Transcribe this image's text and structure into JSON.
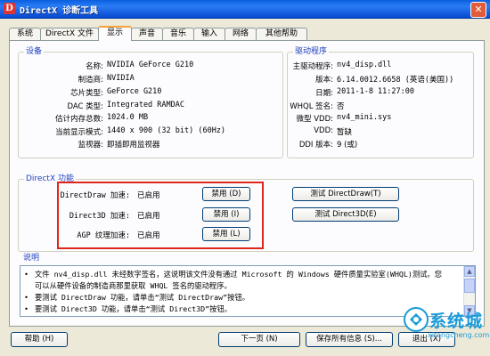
{
  "window": {
    "title": "DirectX 诊断工具",
    "close_glyph": "✕",
    "app_icon_glyph": "D"
  },
  "tabs": [
    {
      "label": "系统"
    },
    {
      "label": "DirectX 文件"
    },
    {
      "label": "显示",
      "active": true
    },
    {
      "label": "声音"
    },
    {
      "label": "音乐"
    },
    {
      "label": "输入"
    },
    {
      "label": "网络"
    },
    {
      "label": "其他帮助"
    }
  ],
  "device": {
    "title": "设备",
    "rows": [
      {
        "label": "名称:",
        "value": "NVIDIA GeForce G210"
      },
      {
        "label": "制造商:",
        "value": "NVIDIA"
      },
      {
        "label": "芯片类型:",
        "value": "GeForce G210"
      },
      {
        "label": "DAC 类型:",
        "value": "Integrated RAMDAC"
      },
      {
        "label": "估计内存总数:",
        "value": "1024.0 MB"
      },
      {
        "label": "当前显示模式:",
        "value": "1440 x 900 (32 bit) (60Hz)"
      },
      {
        "label": "监视器:",
        "value": "即插即用监视器"
      }
    ]
  },
  "driver": {
    "title": "驱动程序",
    "rows": [
      {
        "label": "主驱动程序:",
        "value": "nv4_disp.dll"
      },
      {
        "label": "版本:",
        "value": "6.14.0012.6658 (英语(美国))"
      },
      {
        "label": "日期:",
        "value": "2011-1-8 11:27:00"
      },
      {
        "label": "WHQL 签名:",
        "value": "否"
      },
      {
        "label": "微型 VDD:",
        "value": "nv4_mini.sys"
      },
      {
        "label": "VDD:",
        "value": "暂缺"
      },
      {
        "label": "DDI 版本:",
        "value": "9 (或)"
      }
    ]
  },
  "directx_features": {
    "title": "DirectX 功能",
    "rows": [
      {
        "label": "DirectDraw 加速:",
        "status": "已启用",
        "button": "禁用 (D)",
        "test_button": "测试 DirectDraw(T)"
      },
      {
        "label": "Direct3D 加速:",
        "status": "已启用",
        "button": "禁用 (I)",
        "test_button": "测试 Direct3D(E)"
      },
      {
        "label": "AGP 纹理加速:",
        "status": "已启用",
        "button": "禁用 (L)"
      }
    ]
  },
  "notes": {
    "title": "说明",
    "lines": [
      "文件 nv4_disp.dll 未经数字签名，这说明该文件没有通过 Microsoft 的 Windows 硬件质量实验室(WHQL)测试。您",
      "可以从硬件设备的制造商那里获取 WHQL 签名的驱动程序。",
      "要测试 DirectDraw 功能，请单击“测试 DirectDraw”按钮。",
      "要测试 Direct3D 功能，请单击“测试 Direct3D”按钮。"
    ]
  },
  "footer": {
    "help": "帮助 (H)",
    "next": "下一页 (N)",
    "save": "保存所有信息 (S)...",
    "exit": "退出 (X)"
  },
  "watermark": {
    "brand": "系统城",
    "url": "xitongcheng.com"
  },
  "colors": {
    "accent_red": "#e0261a",
    "group_title": "#1f3fbf",
    "title_bar": "#0a5fe0"
  }
}
